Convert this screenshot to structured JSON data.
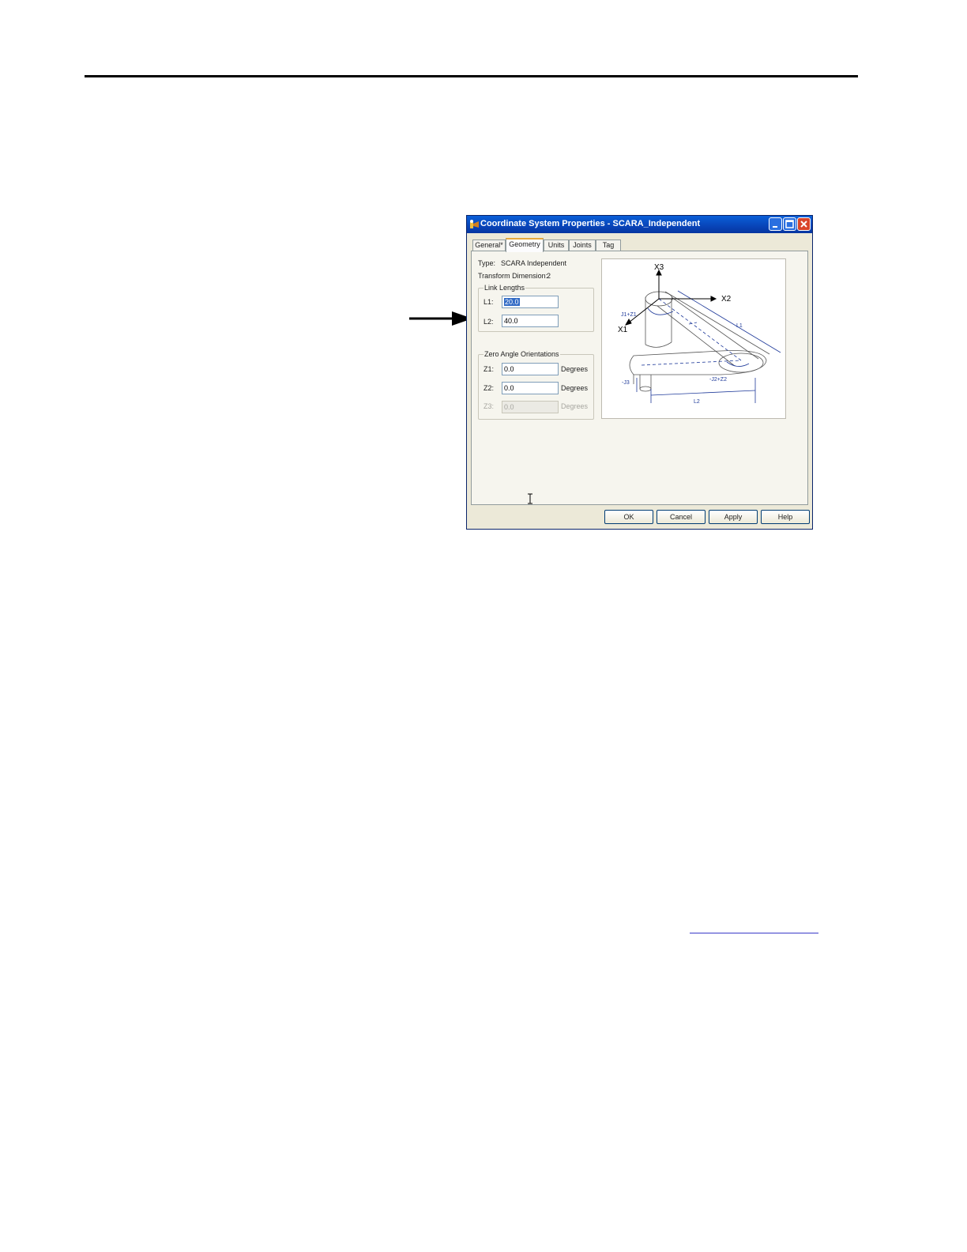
{
  "window": {
    "title": "Coordinate System Properties - SCARA_Independent",
    "minimize_glyph": "_",
    "maximize_glyph": "□",
    "close_glyph": "✕"
  },
  "tabs": [
    {
      "label": "General*"
    },
    {
      "label": "Geometry"
    },
    {
      "label": "Units"
    },
    {
      "label": "Joints"
    },
    {
      "label": "Tag"
    }
  ],
  "geometry": {
    "type_label": "Type:",
    "type_value": "SCARA Independent",
    "transform_label": "Transform Dimension:",
    "transform_value": "2",
    "link_lengths": {
      "title": "Link Lengths",
      "l1_label": "L1:",
      "l1_value": "20.0",
      "l2_label": "L2:",
      "l2_value": "40.0"
    },
    "zero_angle": {
      "title": "Zero Angle Orientations",
      "z1_label": "Z1:",
      "z1_value": "0.0",
      "z1_unit": "Degrees",
      "z2_label": "Z2:",
      "z2_value": "0.0",
      "z2_unit": "Degrees",
      "z3_label": "Z3:",
      "z3_value": "0.0",
      "z3_unit": "Degrees"
    },
    "diagram": {
      "x1": "X1",
      "x2": "X2",
      "x3": "X3",
      "j1z1": "J1+Z1",
      "j2z2": "-J2+Z2",
      "j3": "-J3",
      "l1": "L1",
      "l2": "L2"
    }
  },
  "buttons": {
    "ok": "OK",
    "cancel": "Cancel",
    "apply": "Apply",
    "help": "Help"
  },
  "colors": {
    "titlebar": "#0a5fd8",
    "dialog_bg": "#ece9d8",
    "diagram_blue": "#1f3a9a"
  }
}
